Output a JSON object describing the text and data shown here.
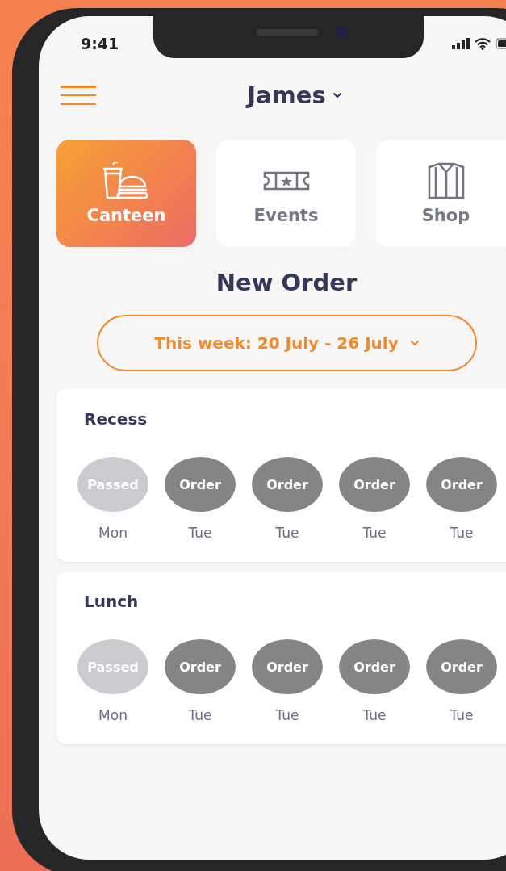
{
  "status_bar": {
    "time": "9:41"
  },
  "header": {
    "name": "James"
  },
  "categories": [
    {
      "label": "Canteen",
      "kind": "food",
      "selected": true
    },
    {
      "label": "Events",
      "kind": "ticket",
      "selected": false
    },
    {
      "label": "Shop",
      "kind": "shirt",
      "selected": false
    }
  ],
  "title": "New Order",
  "week_selector": {
    "label": "This week: 20 July - 26 July"
  },
  "meals": [
    {
      "name": "Recess",
      "slots": [
        {
          "kind": "passed",
          "label": "Passed",
          "day": "Mon"
        },
        {
          "kind": "order",
          "label": "Order",
          "day": "Tue"
        },
        {
          "kind": "order",
          "label": "Order",
          "day": "Tue"
        },
        {
          "kind": "order",
          "label": "Order",
          "day": "Tue"
        },
        {
          "kind": "order",
          "label": "Order",
          "day": "Tue"
        }
      ]
    },
    {
      "name": "Lunch",
      "slots": [
        {
          "kind": "passed",
          "label": "Passed",
          "day": "Mon"
        },
        {
          "kind": "order",
          "label": "Order",
          "day": "Tue"
        },
        {
          "kind": "order",
          "label": "Order",
          "day": "Tue"
        },
        {
          "kind": "order",
          "label": "Order",
          "day": "Tue"
        },
        {
          "kind": "order",
          "label": "Order",
          "day": "Tue"
        }
      ]
    }
  ]
}
